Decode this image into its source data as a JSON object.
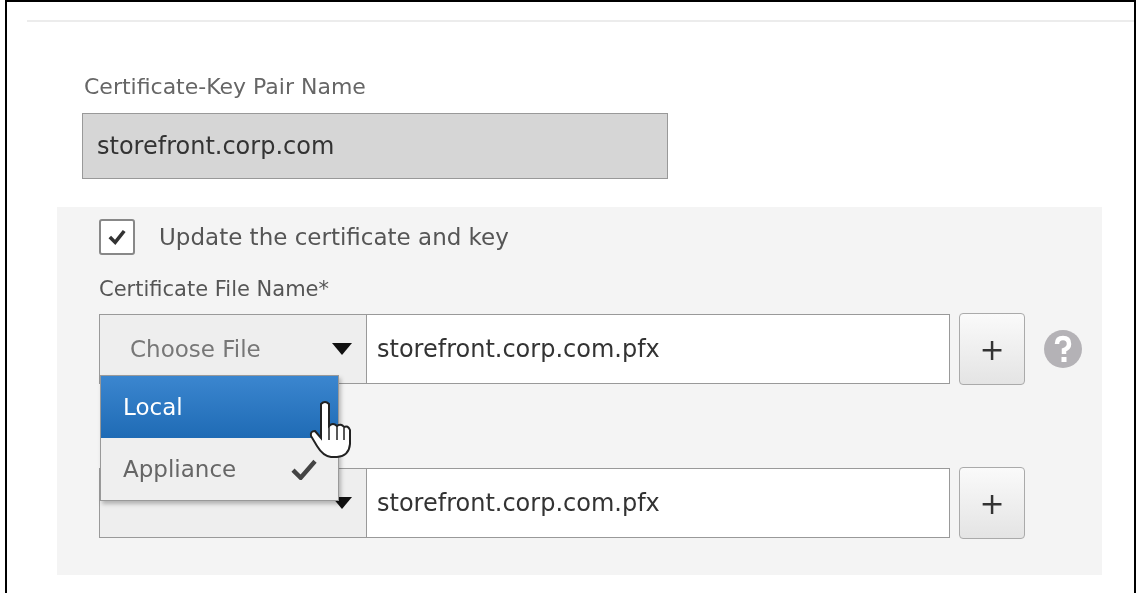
{
  "panel": {
    "name_field": {
      "label": "Certificate-Key Pair Name",
      "value": "storefront.corp.com",
      "disabled": true
    },
    "update_checkbox": {
      "label": "Update the certificate and key",
      "checked": true
    },
    "file_rows": [
      {
        "label": "Certificate File Name*",
        "chooser": "Choose File",
        "value": "storefront.corp.com.pfx",
        "add": "+",
        "help": true
      },
      {
        "value": "storefront.corp.com.pfx",
        "add": "+",
        "help": false
      }
    ],
    "dropdown": {
      "options": [
        {
          "label": "Local",
          "selected": true,
          "checked": false
        },
        {
          "label": "Appliance",
          "selected": false,
          "checked": true
        }
      ]
    }
  }
}
